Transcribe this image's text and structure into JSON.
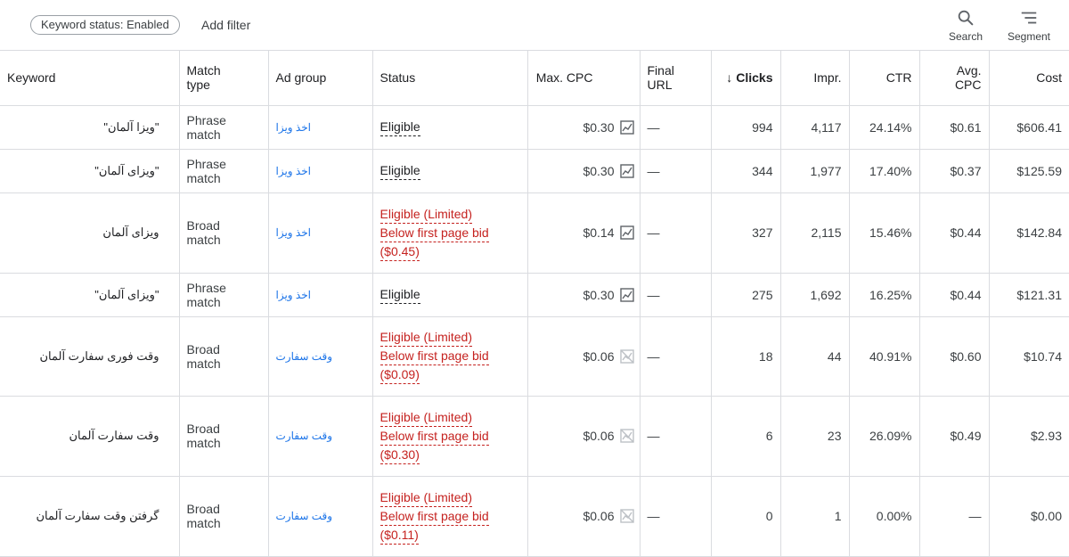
{
  "filters": {
    "chip_label": "Keyword status: Enabled",
    "add_filter_label": "Add filter"
  },
  "toolbar": {
    "search_label": "Search",
    "segment_label": "Segment",
    "search_icon": "search-icon",
    "segment_icon": "segment-icon"
  },
  "table": {
    "headers": {
      "keyword": "Keyword",
      "match_type_1": "Match",
      "match_type_2": "type",
      "ad_group": "Ad group",
      "status": "Status",
      "max_cpc": "Max. CPC",
      "final_url_1": "Final",
      "final_url_2": "URL",
      "clicks_arrow": "↓",
      "clicks": "Clicks",
      "impr": "Impr.",
      "ctr": "CTR",
      "avg_cpc": "Avg. CPC",
      "cost": "Cost"
    },
    "rows": [
      {
        "keyword": "\"ویزا آلمان\"",
        "match1": "Phrase",
        "match2": "match",
        "ad_group": "اخذ ویزا",
        "status1": "Eligible",
        "status2": "",
        "status3": "",
        "max_cpc": "$0.30",
        "final_url": "—",
        "clicks": "994",
        "impr": "4,117",
        "ctr": "24.14%",
        "avg_cpc": "$0.61",
        "cost": "$606.41"
      },
      {
        "keyword": "\"ویزای آلمان\"",
        "match1": "Phrase",
        "match2": "match",
        "ad_group": "اخذ ویزا",
        "status1": "Eligible",
        "status2": "",
        "status3": "",
        "max_cpc": "$0.30",
        "final_url": "—",
        "clicks": "344",
        "impr": "1,977",
        "ctr": "17.40%",
        "avg_cpc": "$0.37",
        "cost": "$125.59"
      },
      {
        "keyword": "ویزای آلمان",
        "match1": "Broad",
        "match2": "match",
        "ad_group": "اخذ ویزا",
        "status1": "Eligible (Limited)",
        "status2": "Below first page bid",
        "status3": "($0.45)",
        "max_cpc": "$0.14",
        "final_url": "—",
        "clicks": "327",
        "impr": "2,115",
        "ctr": "15.46%",
        "avg_cpc": "$0.44",
        "cost": "$142.84"
      },
      {
        "keyword": "\"ویزای آلمان\"",
        "match1": "Phrase",
        "match2": "match",
        "ad_group": "اخذ ویزا",
        "status1": "Eligible",
        "status2": "",
        "status3": "",
        "max_cpc": "$0.30",
        "final_url": "—",
        "clicks": "275",
        "impr": "1,692",
        "ctr": "16.25%",
        "avg_cpc": "$0.44",
        "cost": "$121.31"
      },
      {
        "keyword": "وقت فوری سفارت آلمان",
        "match1": "Broad",
        "match2": "match",
        "ad_group": "وقت سفارت",
        "status1": "Eligible (Limited)",
        "status2": "Below first page bid",
        "status3": "($0.09)",
        "max_cpc": "$0.06",
        "final_url": "—",
        "clicks": "18",
        "impr": "44",
        "ctr": "40.91%",
        "avg_cpc": "$0.60",
        "cost": "$10.74"
      },
      {
        "keyword": "وقت سفارت آلمان",
        "match1": "Broad",
        "match2": "match",
        "ad_group": "وقت سفارت",
        "status1": "Eligible (Limited)",
        "status2": "Below first page bid",
        "status3": "($0.30)",
        "max_cpc": "$0.06",
        "final_url": "—",
        "clicks": "6",
        "impr": "23",
        "ctr": "26.09%",
        "avg_cpc": "$0.49",
        "cost": "$2.93"
      },
      {
        "keyword": "گرفتن وقت سفارت آلمان",
        "match1": "Broad",
        "match2": "match",
        "ad_group": "وقت سفارت",
        "status1": "Eligible (Limited)",
        "status2": "Below first page bid",
        "status3": "($0.11)",
        "max_cpc": "$0.06",
        "final_url": "—",
        "clicks": "0",
        "impr": "1",
        "ctr": "0.00%",
        "avg_cpc": "—",
        "cost": "$0.00"
      }
    ]
  },
  "colors": {
    "link": "#1a73e8",
    "limited": "#c5221f",
    "border": "#dadce0"
  }
}
